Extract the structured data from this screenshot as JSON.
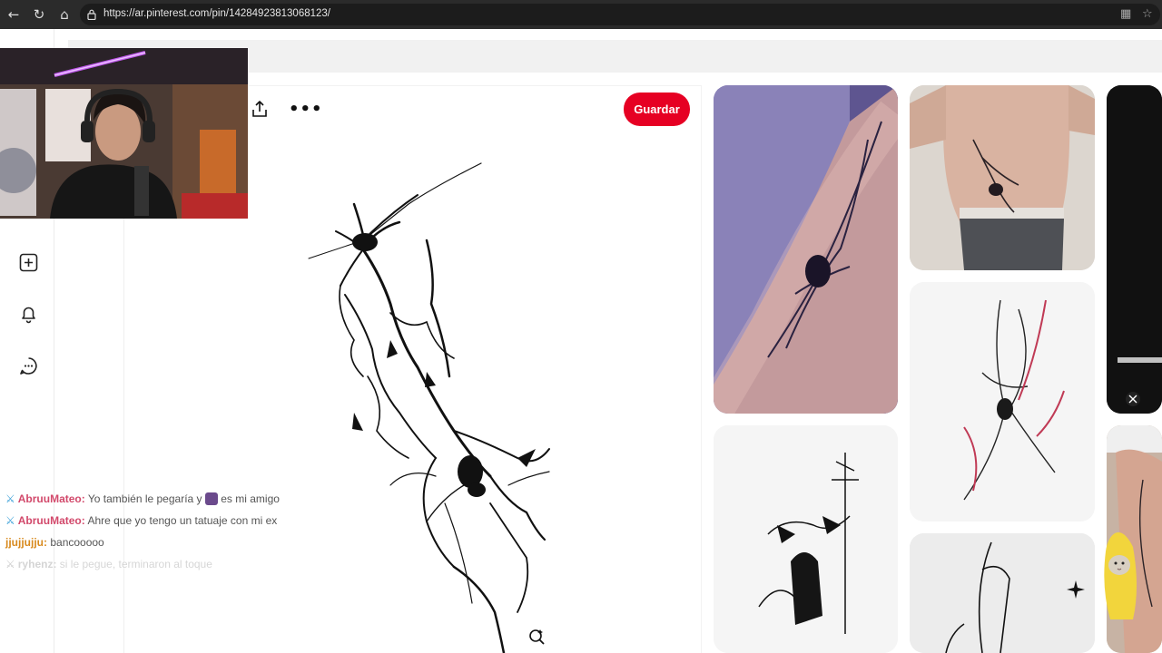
{
  "browser": {
    "url": "https://ar.pinterest.com/pin/14284923813068123/",
    "back_icon": "arrow-left-icon",
    "reload_icon": "reload-icon",
    "home_icon": "home-icon"
  },
  "sidebar": {
    "items": [
      {
        "name": "create",
        "icon": "plus-square-icon"
      },
      {
        "name": "notifications",
        "icon": "bell-icon"
      },
      {
        "name": "messages",
        "icon": "chat-bubble-icon"
      }
    ]
  },
  "pin": {
    "save_label": "Guardar",
    "share_icon": "share-icon",
    "more_icon": "more-dots-icon",
    "lens_icon": "visual-search-icon"
  },
  "chat": {
    "messages": [
      {
        "user": "AbruuMateo:",
        "text": "Yo también le pegaría y",
        "text2": "es mi amigo",
        "color": "#d2496b"
      },
      {
        "user": "AbruuMateo:",
        "text": "Ahre que yo tengo un tatuaje con mi ex",
        "text2": "",
        "color": "#d2496b"
      },
      {
        "user": "jjujjujju:",
        "text": "bancooooo",
        "text2": "",
        "color": "#d88a1e"
      },
      {
        "user": "ryhenz:",
        "text": "si le pegue, terminaron al toque",
        "text2": "",
        "color": "#b9b9b9"
      }
    ]
  },
  "colors": {
    "brand": "#e60023"
  }
}
